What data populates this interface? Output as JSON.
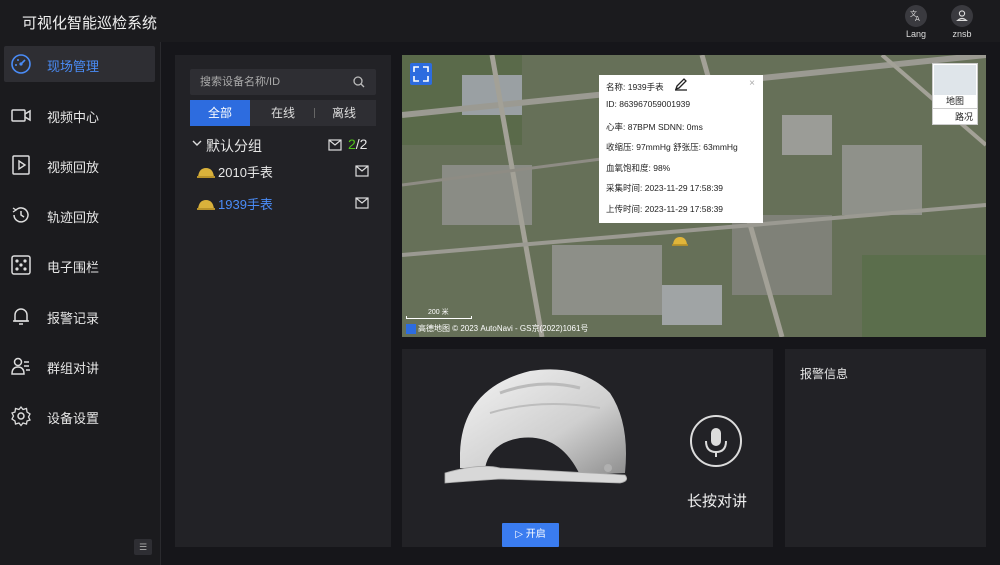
{
  "app": {
    "title": "可视化智能巡检系统"
  },
  "header": {
    "lang": {
      "icon": "translate-icon",
      "label": "Lang"
    },
    "user": {
      "icon": "user-icon",
      "label": "znsb"
    }
  },
  "sidebar": {
    "items": [
      {
        "label": "现场管理",
        "icon": "dashboard-icon",
        "active": true
      },
      {
        "label": "视频中心",
        "icon": "video-camera-icon"
      },
      {
        "label": "视频回放",
        "icon": "play-file-icon"
      },
      {
        "label": "轨迹回放",
        "icon": "history-icon"
      },
      {
        "label": "电子围栏",
        "icon": "fence-icon"
      },
      {
        "label": "报警记录",
        "icon": "bell-icon"
      },
      {
        "label": "群组对讲",
        "icon": "group-icon"
      },
      {
        "label": "设备设置",
        "icon": "gear-icon"
      }
    ],
    "collapse_label": "☰"
  },
  "devices": {
    "search_placeholder": "搜索设备名称/ID",
    "tabs": [
      "全部",
      "在线",
      "离线"
    ],
    "group": {
      "name": "默认分组",
      "online": "2",
      "total": "/2"
    },
    "items": [
      {
        "name": "2010手表",
        "selected": false
      },
      {
        "name": "1939手表",
        "selected": true
      }
    ]
  },
  "map": {
    "popup": {
      "name": "名称: 1939手表",
      "id": "ID: 863967059001939",
      "heart": "心率: 87BPM   SDNN: 0ms",
      "bp": "收缩压: 97mmHg   舒张压: 63mmHg",
      "spo2": "血氧饱和度: 98%",
      "collect_time": "采集时间: 2023-11-29 17:58:39",
      "upload_time": "上传时间: 2023-11-29 17:58:39",
      "close": "×"
    },
    "type_switch": {
      "map": "地图",
      "road": "路况"
    },
    "scale": "200 米",
    "copyright": "高德地图 © 2023 AutoNavi - GS京(2022)1061号"
  },
  "helmet": {
    "start_label": "▷ 开启",
    "talk_label": "长按对讲"
  },
  "alarm": {
    "title": "报警信息"
  },
  "colors": {
    "accent": "#2d6cdf",
    "online": "#52c41a",
    "bg": "#1b1b1e",
    "panel": "#222226"
  }
}
